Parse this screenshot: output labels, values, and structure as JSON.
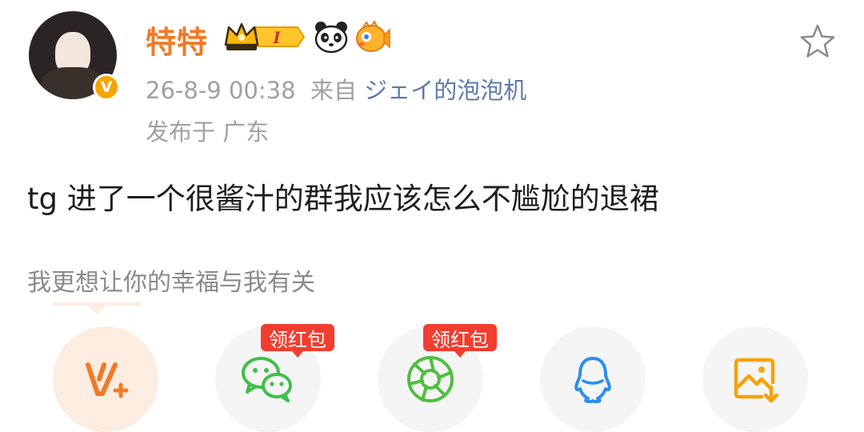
{
  "post": {
    "author": "特特",
    "timestamp": "26-8-9 00:38",
    "source_prefix": "来自",
    "source": "ジェイ的泡泡机",
    "location": "发布于 广东",
    "content": "tg 进了一个很酱汁的群我应该怎么不尴尬的退裙",
    "badges": {
      "crown_level": "I"
    }
  },
  "share": {
    "hint": "我更想让你的幸福与我有关",
    "buttons": [
      {
        "name": "share-weibo-v",
        "icon": "v-plus-icon"
      },
      {
        "name": "share-wechat",
        "icon": "wechat-icon",
        "tag": "领红包"
      },
      {
        "name": "share-moments",
        "icon": "moments-icon",
        "tag": "领红包"
      },
      {
        "name": "share-qq",
        "icon": "qq-icon"
      },
      {
        "name": "share-save-image",
        "icon": "save-image-icon"
      }
    ]
  },
  "colors": {
    "name": "#f07a27",
    "source_link": "#5c7ba6",
    "meta": "#a0a0a0",
    "tag": "#f23d2f",
    "verified": "#f6a500"
  }
}
